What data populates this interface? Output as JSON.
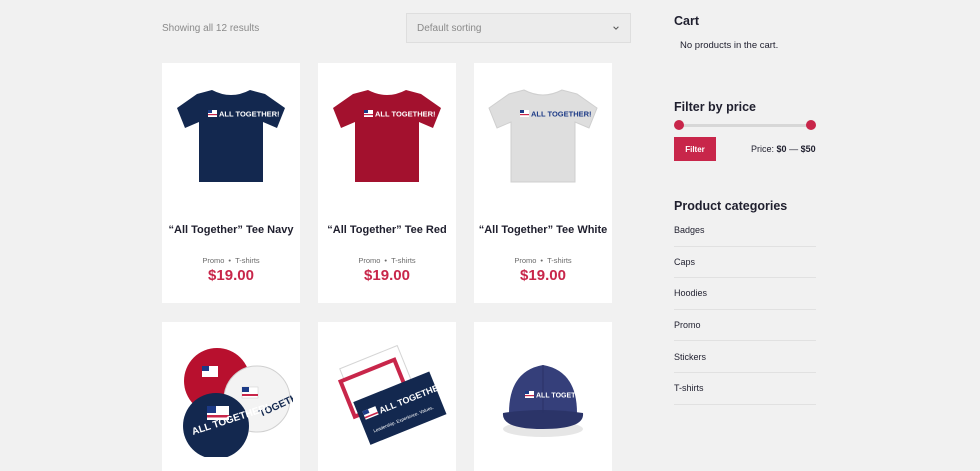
{
  "shop": {
    "results_count": "Showing all 12 results",
    "sort_value": "Default sorting"
  },
  "products": [
    {
      "title": "“All Together” Tee Navy",
      "categories": [
        "Promo",
        "T-shirts"
      ],
      "price": "$19.00",
      "image": "tshirt-navy",
      "color": "#13284f"
    },
    {
      "title": "“All Together” Tee Red",
      "categories": [
        "Promo",
        "T-shirts"
      ],
      "price": "$19.00",
      "image": "tshirt-red",
      "color": "#a3112e"
    },
    {
      "title": "“All Together” Tee White",
      "categories": [
        "Promo",
        "T-shirts"
      ],
      "price": "$19.00",
      "image": "tshirt-white",
      "color": "#e2e2e2"
    },
    {
      "image": "badges"
    },
    {
      "image": "stickers"
    },
    {
      "image": "cap-navy"
    }
  ],
  "sidebar": {
    "cart_title": "Cart",
    "cart_empty": "No products in the cart.",
    "filter_title": "Filter by price",
    "filter_button": "Filter",
    "price_label": "Price:",
    "price_min": "$0",
    "price_sep": "—",
    "price_max": "$50",
    "categories_title": "Product categories",
    "categories": [
      "Badges",
      "Caps",
      "Hoodies",
      "Promo",
      "Stickers",
      "T-shirts"
    ]
  },
  "colors": {
    "accent": "#c8264a",
    "navy": "#13284f",
    "background": "#f1f1f1"
  }
}
